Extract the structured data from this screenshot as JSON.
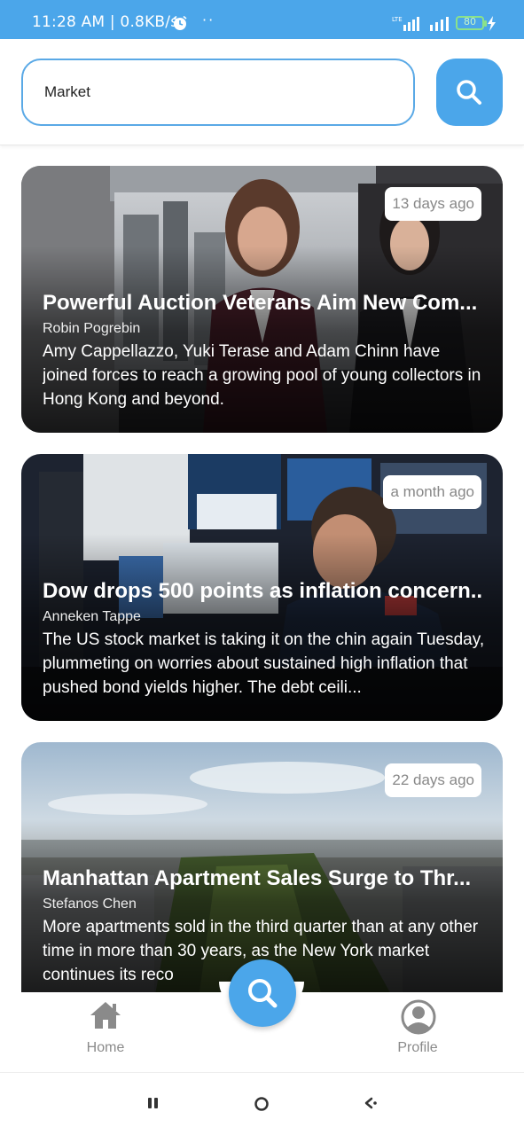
{
  "status_bar": {
    "time": "11:28 AM | 0.8KB/s",
    "dots": "··",
    "network": "LTE",
    "battery": "80",
    "colors": {
      "bar": "#4ba6ea",
      "battery": "#8be28a"
    }
  },
  "search": {
    "value": "Market",
    "button_icon": "search-icon"
  },
  "articles": [
    {
      "title": "Powerful Auction Veterans Aim New Com...",
      "author": "Robin Pogrebin",
      "description": "Amy Cappellazzo, Yuki Terase and Adam Chinn have joined forces to reach a growing pool of young collectors in Hong Kong and beyond.",
      "time_ago": "13 days ago"
    },
    {
      "title": "Dow drops 500 points as inflation concern..",
      "author": "Anneken Tappe",
      "description": "The US stock market is taking it on the chin again Tuesday, plummeting on worries about sustained high inflation that pushed bond yields higher. The debt ceili...",
      "time_ago": "a month ago"
    },
    {
      "title": "Manhattan Apartment Sales Surge to Thr...",
      "author": "Stefanos Chen",
      "description": "More apartments sold in the third quarter than at any other time in more than 30 years, as the New York market continues its reco",
      "time_ago": "22 days ago"
    }
  ],
  "tab_bar": {
    "home_label": "Home",
    "profile_label": "Profile",
    "fab_icon": "search-icon"
  },
  "system_nav": [
    "recent-apps-icon",
    "home-circle-icon",
    "back-icon"
  ],
  "colors": {
    "accent": "#4ba6ea",
    "tab_label": "#8a8a8a"
  }
}
